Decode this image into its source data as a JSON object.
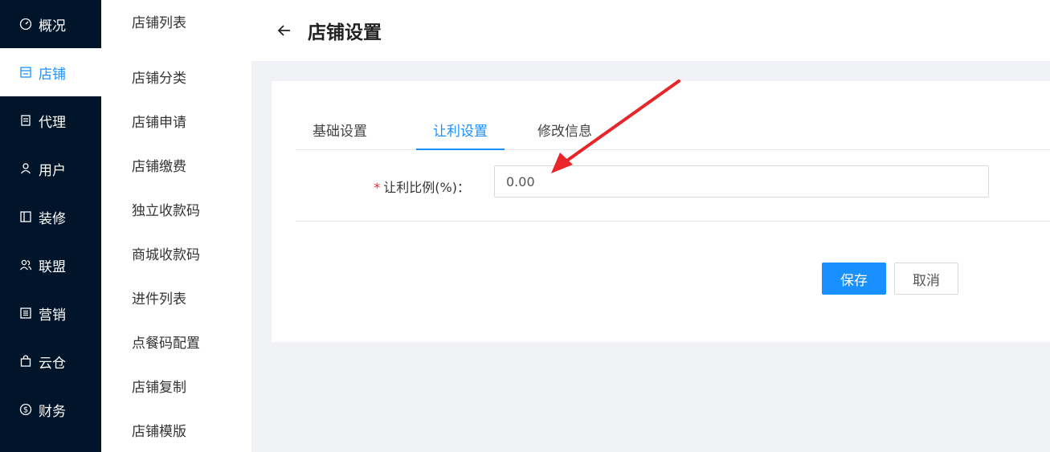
{
  "nav": {
    "items": [
      {
        "label": "概况",
        "icon": "dashboard-icon"
      },
      {
        "label": "店铺",
        "icon": "shop-icon",
        "active": true
      },
      {
        "label": "代理",
        "icon": "agent-icon"
      },
      {
        "label": "用户",
        "icon": "user-icon"
      },
      {
        "label": "装修",
        "icon": "layout-icon"
      },
      {
        "label": "联盟",
        "icon": "team-icon"
      },
      {
        "label": "营销",
        "icon": "marketing-icon"
      },
      {
        "label": "云仓",
        "icon": "bag-icon"
      },
      {
        "label": "财务",
        "icon": "dollar-icon"
      }
    ]
  },
  "submenu": {
    "items": [
      "店铺列表",
      "店铺分类",
      "店铺申请",
      "店铺缴费",
      "独立收款码",
      "商城收款码",
      "进件列表",
      "点餐码配置",
      "店铺复制",
      "店铺模版"
    ]
  },
  "header": {
    "title": "店铺设置"
  },
  "tabs": [
    "基础设置",
    "让利设置",
    "修改信息"
  ],
  "active_tab": "让利设置",
  "form": {
    "label": "让利比例(%)：",
    "required_mark": "*",
    "value": "0.00"
  },
  "buttons": {
    "save": "保存",
    "cancel": "取消"
  },
  "colors": {
    "accent": "#1890ff",
    "nav_bg": "#001529",
    "annotation_arrow": "#e8262a"
  }
}
